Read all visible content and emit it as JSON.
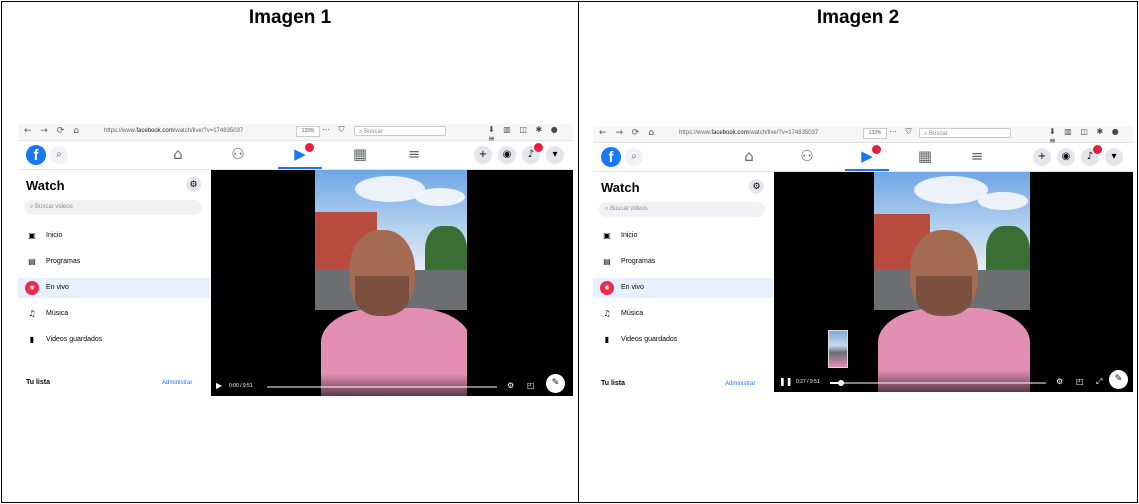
{
  "cells": [
    {
      "title": "Imagen 1",
      "browser": {
        "url_prefix": "https://www.",
        "url_host": "facebook.com",
        "url_path": "/watch/live/?v=174835037",
        "zoom": "133%",
        "search_placeholder": "Buscar"
      },
      "sidebar": {
        "title": "Watch",
        "search_placeholder": "Buscar videos",
        "items": [
          {
            "label": "Inicio",
            "icon": "tv-icon"
          },
          {
            "label": "Programas",
            "icon": "shows-icon"
          },
          {
            "label": "En vivo",
            "icon": "live-icon",
            "active": true
          },
          {
            "label": "Música",
            "icon": "music-icon"
          },
          {
            "label": "Videos guardados",
            "icon": "bookmark-icon"
          }
        ],
        "list_title": "Tu lista",
        "list_action": "Administrar"
      },
      "player": {
        "time": "0:00 / 9:51",
        "progress": 0.0
      }
    },
    {
      "title": "Imagen 2",
      "browser": {
        "url_prefix": "https://www.",
        "url_host": "facebook.com",
        "url_path": "/watch/live/?v=174835037",
        "zoom": "133%",
        "search_placeholder": "Buscar"
      },
      "sidebar": {
        "title": "Watch",
        "search_placeholder": "Buscar videos",
        "items": [
          {
            "label": "Inicio",
            "icon": "tv-icon"
          },
          {
            "label": "Programas",
            "icon": "shows-icon"
          },
          {
            "label": "En vivo",
            "icon": "live-icon",
            "active": true
          },
          {
            "label": "Música",
            "icon": "music-icon"
          },
          {
            "label": "Videos guardados",
            "icon": "bookmark-icon"
          }
        ],
        "list_title": "Tu lista",
        "list_action": "Administrar"
      },
      "player": {
        "time": "0:27 / 9:51",
        "progress": 0.05
      }
    }
  ],
  "colors": {
    "facebook_blue": "#1877f2",
    "live_red": "#f02849",
    "active_bg": "#e7f0fd"
  }
}
